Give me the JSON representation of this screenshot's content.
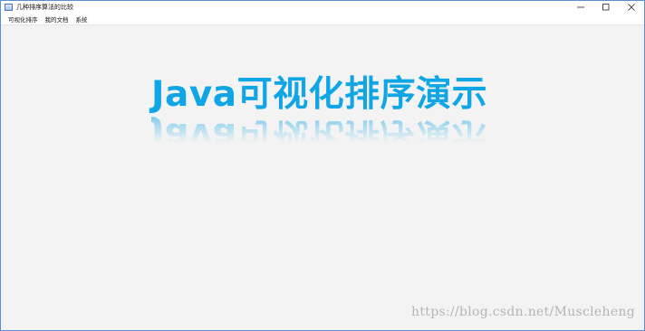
{
  "window": {
    "title": "几种排序算法的比较",
    "icon": "app-window-icon"
  },
  "controls": {
    "minimize_icon": "minimize-icon",
    "maximize_icon": "maximize-icon",
    "close_icon": "close-icon"
  },
  "menubar": {
    "items": [
      {
        "label": "可视化排序"
      },
      {
        "label": "我的文档"
      },
      {
        "label": "系统"
      }
    ]
  },
  "main": {
    "headline": "Java可视化排序演示",
    "headline_color": "#10a6e6"
  },
  "watermark": {
    "text": "https://blog.csdn.net/Muscleheng"
  }
}
